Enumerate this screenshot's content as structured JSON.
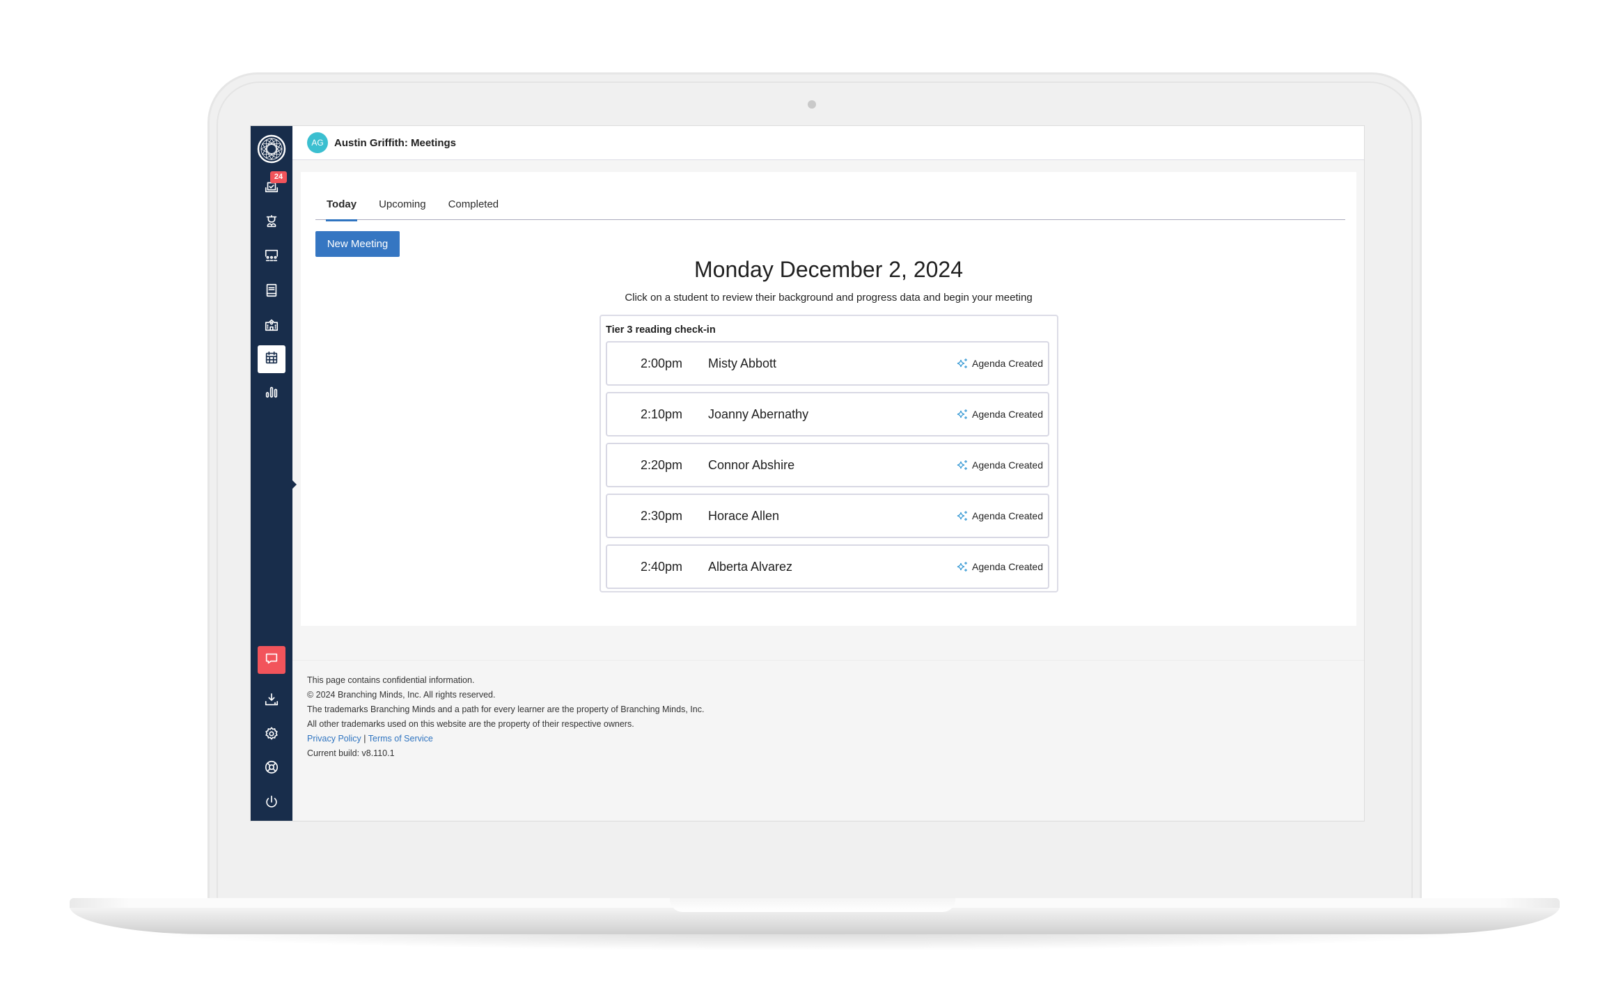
{
  "header": {
    "avatar_initials": "AG",
    "title": "Austin Griffith: Meetings"
  },
  "sidebar": {
    "notification_count": "24",
    "items": [
      {
        "name": "logo",
        "icon": "branching-minds-logo-icon"
      },
      {
        "name": "tasks",
        "icon": "clipboard-check-icon"
      },
      {
        "name": "students",
        "icon": "graduate-student-icon"
      },
      {
        "name": "classes",
        "icon": "classroom-icon"
      },
      {
        "name": "library",
        "icon": "book-icon"
      },
      {
        "name": "school",
        "icon": "school-building-icon"
      },
      {
        "name": "meetings",
        "icon": "calendar-icon",
        "active": true
      },
      {
        "name": "reports",
        "icon": "bar-chart-icon"
      }
    ],
    "bottom_items": [
      {
        "name": "feedback",
        "icon": "chat-bubble-icon"
      },
      {
        "name": "downloads",
        "icon": "download-tray-icon"
      },
      {
        "name": "settings",
        "icon": "gear-icon"
      },
      {
        "name": "help",
        "icon": "lifebuoy-icon"
      },
      {
        "name": "logout",
        "icon": "power-icon"
      }
    ]
  },
  "tabs": [
    {
      "label": "Today",
      "active": true
    },
    {
      "label": "Upcoming"
    },
    {
      "label": "Completed"
    }
  ],
  "new_meeting_label": "New Meeting",
  "date_heading": "Monday December 2, 2024",
  "subtitle": "Click on a student to review their background and progress data and begin your meeting",
  "group": {
    "title": "Tier 3 reading check-in",
    "meetings": [
      {
        "time": "2:00pm",
        "student": "Misty Abbott",
        "status": "Agenda Created"
      },
      {
        "time": "2:10pm",
        "student": "Joanny Abernathy",
        "status": "Agenda Created"
      },
      {
        "time": "2:20pm",
        "student": "Connor Abshire",
        "status": "Agenda Created"
      },
      {
        "time": "2:30pm",
        "student": "Horace Allen",
        "status": "Agenda Created"
      },
      {
        "time": "2:40pm",
        "student": "Alberta Alvarez",
        "status": "Agenda Created"
      }
    ]
  },
  "footer": {
    "confidential": "This page contains confidential information.",
    "copyright": "© 2024 Branching Minds, Inc. All rights reserved.",
    "trademark_1": "The trademarks Branching Minds and a path for every learner are the property of Branching Minds, Inc.",
    "trademark_2": "All other trademarks used on this website are the property of their respective owners.",
    "privacy_link": "Privacy Policy",
    "separator": "|",
    "terms_link": "Terms of Service",
    "build": "Current build: v8.110.1"
  },
  "colors": {
    "sidebar_bg": "#182d4b",
    "accent_blue": "#3576c2",
    "badge_red": "#f2545b",
    "avatar_teal": "#3bbfd0",
    "sparkle_blue": "#3a9bd5"
  }
}
